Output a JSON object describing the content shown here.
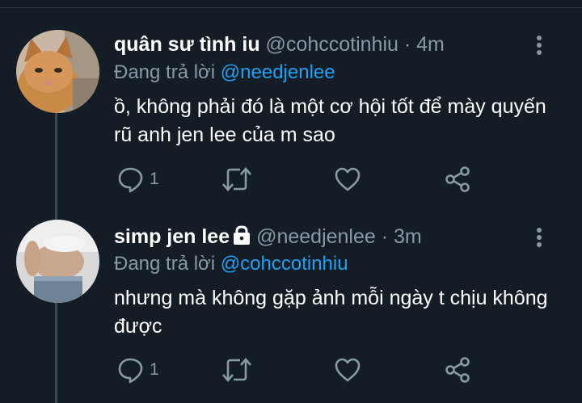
{
  "tweets": [
    {
      "name": "quân sư tình iu",
      "handle": "@cohccotinhiu",
      "separator": "·",
      "time": "4m",
      "reply_prefix": "Đang trả lời",
      "reply_to": "@needjenlee",
      "text": "ồ, không phải đó là một cơ hội tốt để mày quyến rũ anh jen lee của m sao",
      "reply_count": "1",
      "protected": false
    },
    {
      "name": "simp jen lee",
      "handle": "@needjenlee",
      "separator": "·",
      "time": "3m",
      "reply_prefix": "Đang trả lời",
      "reply_to": "@cohccotinhiu",
      "text": "nhưng mà không gặp ảnh mỗi ngày t chịu không được",
      "reply_count": "1",
      "protected": true
    }
  ],
  "icons": {
    "reply": "speech-bubble-icon",
    "retweet": "retweet-icon",
    "like": "heart-icon",
    "share": "share-icon",
    "more": "vertical-dots-icon",
    "protected": "lock-icon"
  },
  "colors": {
    "background": "#141d26",
    "text": "#ffffff",
    "muted": "#8899a6",
    "link": "#1da1f2",
    "thread_line": "#3d4a56"
  }
}
